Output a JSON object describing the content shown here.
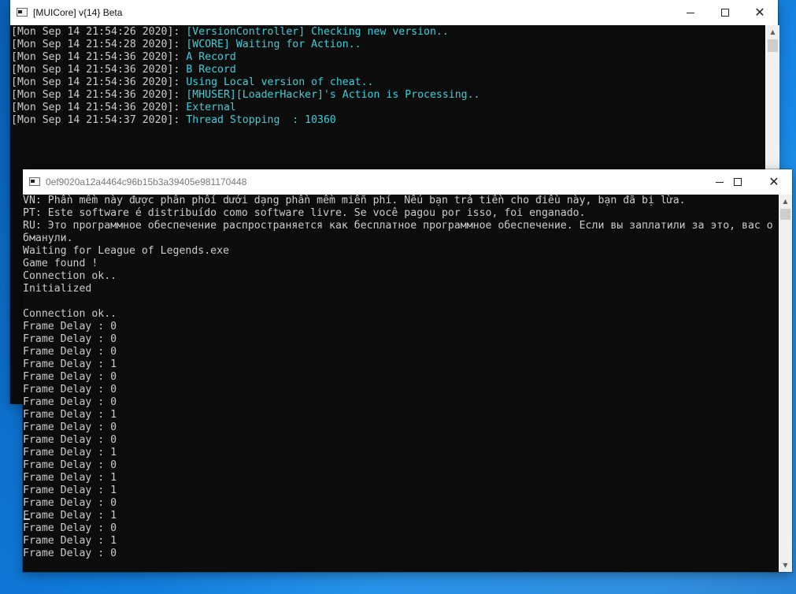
{
  "window1": {
    "title": "[MUICore] v{14} Beta",
    "log": [
      {
        "ts": "[Mon Sep 14 21:54:26 2020]: ",
        "msg": "[VersionController] Checking new version.."
      },
      {
        "ts": "[Mon Sep 14 21:54:28 2020]: ",
        "msg": "[WCORE] Waiting for Action.."
      },
      {
        "ts": "[Mon Sep 14 21:54:36 2020]: ",
        "msg": "A Record"
      },
      {
        "ts": "[Mon Sep 14 21:54:36 2020]: ",
        "msg": "B Record"
      },
      {
        "ts": "[Mon Sep 14 21:54:36 2020]: ",
        "msg": "Using Local version of cheat.."
      },
      {
        "ts": "[Mon Sep 14 21:54:36 2020]: ",
        "msg": "[MHUSER][LoaderHacker]'s Action is Processing.."
      },
      {
        "ts": "[Mon Sep 14 21:54:36 2020]: ",
        "msg": "External"
      },
      {
        "ts": "[Mon Sep 14 21:54:37 2020]: ",
        "msg": "Thread Stopping  : 10360"
      }
    ]
  },
  "window2": {
    "title": "0ef9020a12a4464c96b15b3a39405e981170448",
    "lines": [
      "VN: Phần mềm này được phân phối dưới dạng phần mềm miễn phí. Nếu bạn trả tiền cho điều này, bạn đã bị lừa.",
      "PT: Este software é distribuído como software livre. Se você pagou por isso, foi enganado.",
      "RU: Это программное обеспечение распространяется как бесплатное программное обеспечение. Если вы заплатили за это, вас о",
      "бманули.",
      "Waiting for League of Legends.exe",
      "Game found !",
      "Connection ok..",
      "Initialized",
      "",
      "Connection ok..",
      "Frame Delay : 0",
      "Frame Delay : 0",
      "Frame Delay : 0",
      "Frame Delay : 1",
      "Frame Delay : 0",
      "Frame Delay : 0",
      "Frame Delay : 0",
      "Frame Delay : 1",
      "Frame Delay : 0",
      "Frame Delay : 0",
      "Frame Delay : 1",
      "Frame Delay : 0",
      "Frame Delay : 1",
      "Frame Delay : 1",
      "Frame Delay : 0",
      "Frame Delay : 1",
      "Frame Delay : 0",
      "Frame Delay : 1",
      "Frame Delay : 0"
    ]
  },
  "colors": {
    "console_bg": "#0c0c0c",
    "console_text": "#cccccc",
    "log_message": "#3bd0dc",
    "desktop_blue": "#0f78d7"
  },
  "icons": [
    "console-app-icon",
    "minimize-icon",
    "maximize-icon",
    "close-icon",
    "scroll-up-arrow-icon",
    "scroll-down-arrow-icon"
  ]
}
